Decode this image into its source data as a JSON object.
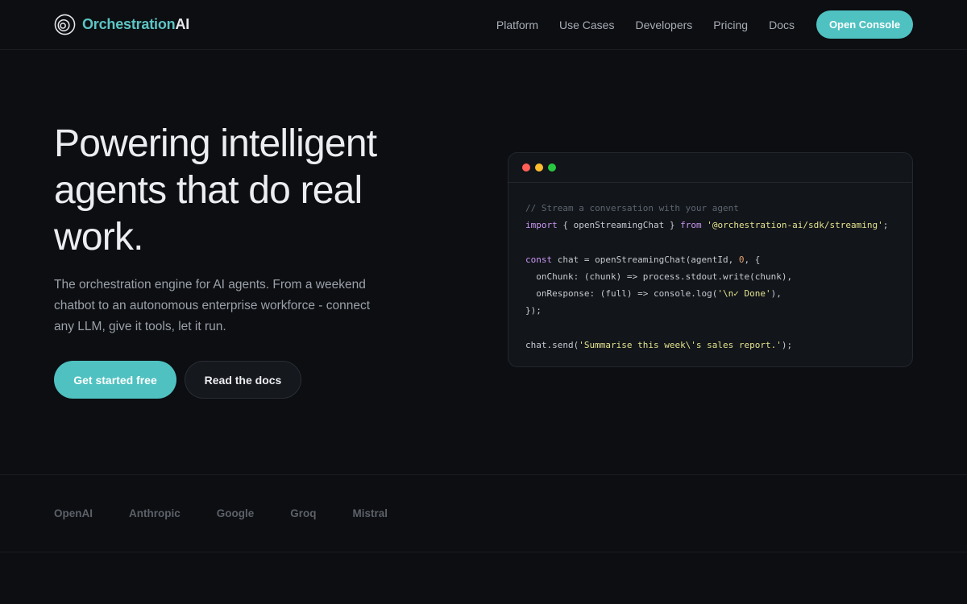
{
  "brand": {
    "name": "Orchestration",
    "suffix": "AI"
  },
  "nav": {
    "links": [
      "Platform",
      "Use Cases",
      "Developers",
      "Pricing",
      "Docs"
    ],
    "cta": "Open Console"
  },
  "hero": {
    "title": "Powering intelligent agents that do real work.",
    "subtitle": "The orchestration engine for AI agents. From a weekend chatbot to an autonomous enterprise workforce - connect any LLM, give it tools, let it run.",
    "primary_button": "Get started free",
    "secondary_button": "Read the docs"
  },
  "code": {
    "window_dots": [
      "#ff5f57",
      "#febc2e",
      "#28c840"
    ],
    "lines": [
      [
        {
          "t": "// Stream a conversation with your agent",
          "k": "comment"
        }
      ],
      [
        {
          "t": "import",
          "k": "keyword"
        },
        {
          "t": " { openStreamingChat } ",
          "k": "plain"
        },
        {
          "t": "from",
          "k": "keyword"
        },
        {
          "t": " ",
          "k": "plain"
        },
        {
          "t": "'@orchestration-ai/sdk/streaming'",
          "k": "string"
        },
        {
          "t": ";",
          "k": "plain"
        }
      ],
      [],
      [
        {
          "t": "const",
          "k": "keyword"
        },
        {
          "t": " chat = openStreamingChat(agentId, ",
          "k": "plain"
        },
        {
          "t": "0",
          "k": "number"
        },
        {
          "t": ", {",
          "k": "plain"
        }
      ],
      [
        {
          "t": "  onChunk: (chunk) => process.stdout.write(chunk),",
          "k": "plain"
        }
      ],
      [
        {
          "t": "  onResponse: (full) => console.log(",
          "k": "plain"
        },
        {
          "t": "'\\n✓ Done'",
          "k": "string"
        },
        {
          "t": "),",
          "k": "plain"
        }
      ],
      [
        {
          "t": "});",
          "k": "plain"
        }
      ],
      [],
      [
        {
          "t": "chat.send(",
          "k": "plain"
        },
        {
          "t": "'Summarise this week\\'s sales report.'",
          "k": "string"
        },
        {
          "t": ");",
          "k": "plain"
        }
      ]
    ]
  },
  "providers": [
    "OpenAI",
    "Anthropic",
    "Google",
    "Groq",
    "Mistral"
  ],
  "colors": {
    "accent": "#4fc1c1",
    "background": "#0c0e12"
  }
}
